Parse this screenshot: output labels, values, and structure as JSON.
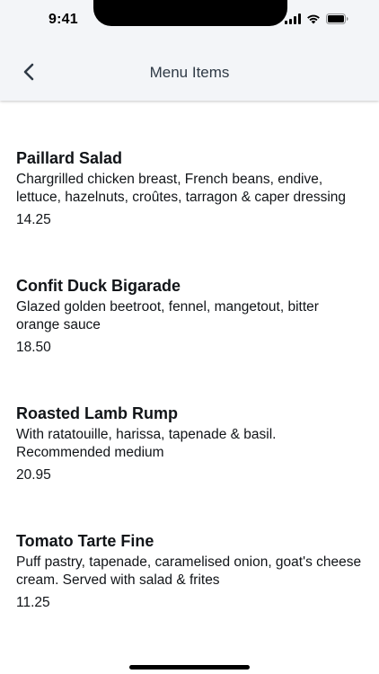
{
  "status_bar": {
    "time": "9:41"
  },
  "nav": {
    "title": "Menu Items",
    "back_icon": "chevron-left-icon"
  },
  "menu_items": [
    {
      "name": "Paillard Salad",
      "description": "Chargrilled chicken breast, French beans, endive, lettuce, hazelnuts, croûtes, tarragon & caper dressing",
      "price": "14.25"
    },
    {
      "name": "Confit Duck Bigarade",
      "description": "Glazed golden beetroot, fennel, mangetout, bitter orange sauce",
      "price": "18.50"
    },
    {
      "name": "Roasted Lamb Rump",
      "description": "With ratatouille, harissa, tapenade & basil. Recommended medium",
      "price": "20.95"
    },
    {
      "name": "Tomato Tarte Fine",
      "description": "Puff pastry, tapenade, caramelised onion, goat's cheese cream. Served with salad & frites",
      "price": "11.25"
    }
  ],
  "colors": {
    "header_bg": "#f3f5f8",
    "title_text": "#2f3a46",
    "body_text": "#111418"
  }
}
